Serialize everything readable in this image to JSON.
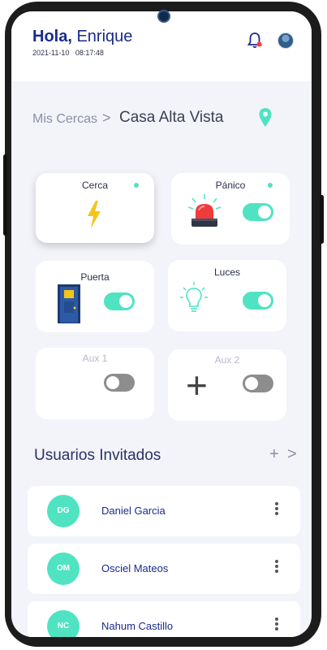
{
  "header": {
    "greeting": "Hola,",
    "user_name": "Enrique",
    "date": "2021-11-10",
    "time": "08:17:48"
  },
  "breadcrumb": {
    "parent": "Mis Cercas",
    "separator": ">",
    "current": "Casa Alta Vista"
  },
  "devices": {
    "cerca": {
      "label": "Cerca",
      "status": "active"
    },
    "panico": {
      "label": "Pánico",
      "toggle": "on"
    },
    "puerta": {
      "label": "Puerta",
      "toggle": "on"
    },
    "luces": {
      "label": "Luces",
      "toggle": "on"
    },
    "aux1": {
      "label": "Aux 1",
      "toggle": "off"
    },
    "aux2": {
      "label": "Aux 2",
      "toggle": "off",
      "add_symbol": "+"
    }
  },
  "guests": {
    "title": "Usuarios Invitados",
    "add_symbol": "+",
    "more_symbol": ">",
    "users": [
      {
        "initials": "DG",
        "name": "Daniel Garcia"
      },
      {
        "initials": "OM",
        "name": "Osciel Mateos"
      },
      {
        "initials": "NC",
        "name": "Nahum Castillo"
      }
    ]
  },
  "colors": {
    "accent": "#4fe3c2",
    "primary_text": "#1a2b8c",
    "toggle_off": "#8d8d8d",
    "background": "#f3f4f9"
  },
  "icons": [
    "bell-icon",
    "avatar",
    "location-pin-icon",
    "lightning-icon",
    "siren-icon",
    "door-icon",
    "lightbulb-icon",
    "plus-icon",
    "more-vertical-icon",
    "chevron-right-icon"
  ]
}
